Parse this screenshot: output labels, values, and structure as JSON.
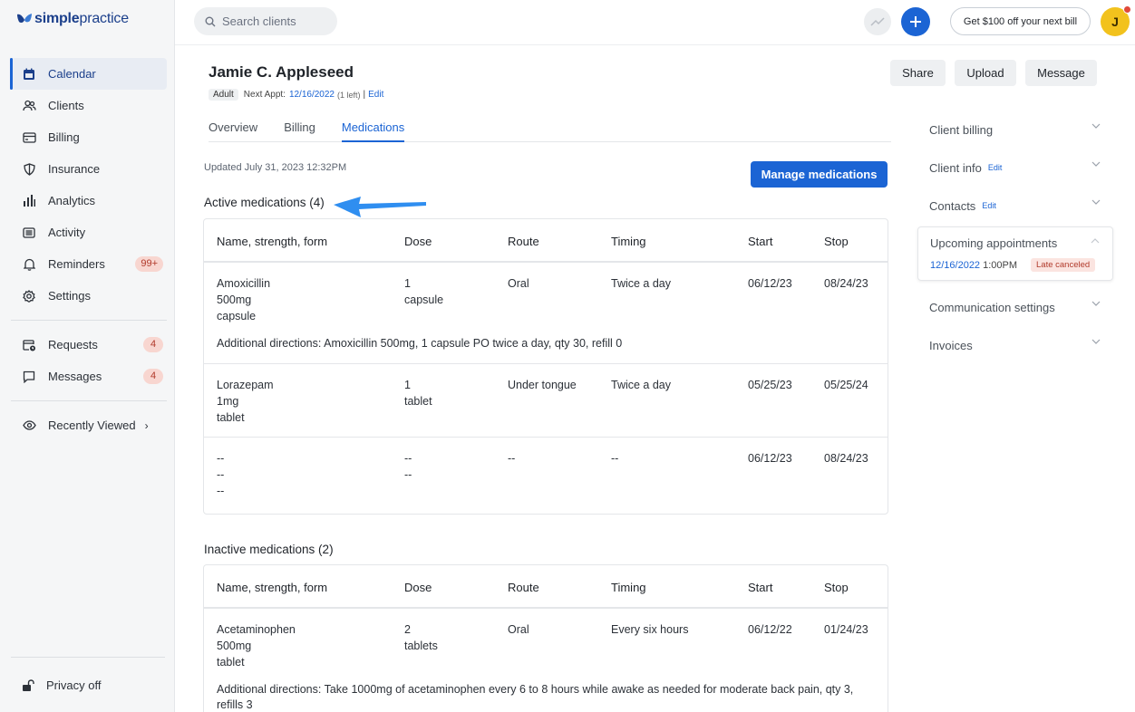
{
  "brand": {
    "name_bold": "simple",
    "name_light": "practice"
  },
  "sidebar": {
    "items": [
      {
        "label": "Calendar",
        "icon": "calendar-icon"
      },
      {
        "label": "Clients",
        "icon": "users-icon"
      },
      {
        "label": "Billing",
        "icon": "credit-card-icon"
      },
      {
        "label": "Insurance",
        "icon": "shield-icon"
      },
      {
        "label": "Analytics",
        "icon": "bar-chart-icon"
      },
      {
        "label": "Activity",
        "icon": "list-icon"
      },
      {
        "label": "Reminders",
        "icon": "bell-icon",
        "badge": "99+"
      },
      {
        "label": "Settings",
        "icon": "gear-icon"
      }
    ],
    "secondary": [
      {
        "label": "Requests",
        "icon": "calendar-clock-icon",
        "badge": "4"
      },
      {
        "label": "Messages",
        "icon": "chat-icon",
        "badge": "4"
      }
    ],
    "recent": {
      "label": "Recently Viewed",
      "chevron": "›"
    },
    "privacy": "Privacy off"
  },
  "topbar": {
    "search_placeholder": "Search clients",
    "promo": "Get $100 off your next bill",
    "avatar_initial": "J"
  },
  "client": {
    "name": "Jamie C. Appleseed",
    "tag": "Adult",
    "next_appt_label": "Next Appt:",
    "next_appt_date": "12/16/2022",
    "next_appt_left": "(1 left)",
    "sep": "|",
    "edit": "Edit"
  },
  "actions": {
    "share": "Share",
    "upload": "Upload",
    "message": "Message"
  },
  "tabs": [
    {
      "label": "Overview"
    },
    {
      "label": "Billing"
    },
    {
      "label": "Medications"
    }
  ],
  "meds": {
    "updated": "Updated July 31, 2023 12:32PM",
    "manage_btn": "Manage medications",
    "columns": [
      "Name, strength, form",
      "Dose",
      "Route",
      "Timing",
      "Start",
      "Stop"
    ],
    "active_title": "Active medications (4)",
    "active": [
      {
        "name": "Amoxicillin",
        "strength": "500mg",
        "form": "capsule",
        "dose1": "1",
        "dose2": "capsule",
        "route": "Oral",
        "timing": "Twice a day",
        "start": "06/12/23",
        "stop": "08/24/23",
        "directions": "Additional directions: Amoxicillin 500mg, 1 capsule PO twice a day, qty 30, refill 0"
      },
      {
        "name": "Lorazepam",
        "strength": "1mg",
        "form": "tablet",
        "dose1": "1",
        "dose2": "tablet",
        "route": "Under tongue",
        "timing": "Twice a day",
        "start": "05/25/23",
        "stop": "05/25/24"
      },
      {
        "name": "--",
        "strength": "--",
        "form": "--",
        "dose1": "--",
        "dose2": "--",
        "route": "--",
        "timing": "--",
        "start": "06/12/23",
        "stop": "08/24/23"
      }
    ],
    "inactive_title": "Inactive medications (2)",
    "inactive": [
      {
        "name": "Acetaminophen",
        "strength": "500mg",
        "form": "tablet",
        "dose1": "2",
        "dose2": "tablets",
        "route": "Oral",
        "timing": "Every six hours",
        "start": "06/12/22",
        "stop": "01/24/23",
        "directions": "Additional directions: Take 1000mg of acetaminophen every 6 to 8 hours while awake as needed for moderate back pain, qty 3, refills 3"
      }
    ]
  },
  "right_panel": {
    "client_billing": "Client billing",
    "client_info": "Client info",
    "contacts": "Contacts",
    "edit": "Edit",
    "upcoming": "Upcoming appointments",
    "upcoming_date": "12/16/2022",
    "upcoming_time": "1:00PM",
    "upcoming_status": "Late canceled",
    "communication": "Communication settings",
    "invoices": "Invoices"
  },
  "colors": {
    "primary": "#1b64d4",
    "brand": "#1b3f8b",
    "badge_bg": "#f8d6d0",
    "avatar": "#f2c21d",
    "arrow": "#2f8ef0"
  }
}
